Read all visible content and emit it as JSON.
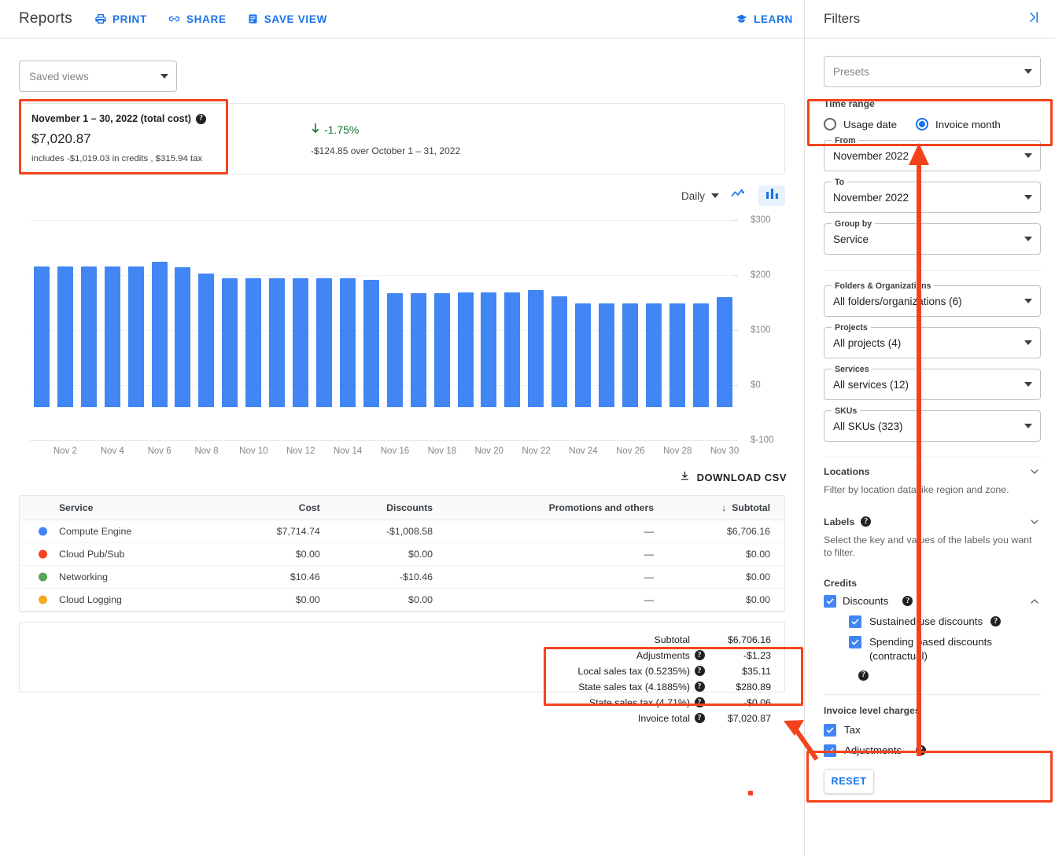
{
  "header": {
    "title": "Reports",
    "actions": [
      {
        "label": "PRINT",
        "icon": "printer-icon"
      },
      {
        "label": "SHARE",
        "icon": "link-icon"
      },
      {
        "label": "SAVE VIEW",
        "icon": "save-document-icon"
      }
    ],
    "learn": {
      "label": "LEARN",
      "icon": "graduation-cap-icon"
    }
  },
  "saved_views": {
    "placeholder": "Saved views"
  },
  "summary": {
    "title": "November 1 – 30, 2022 (total cost)",
    "amount": "$7,020.87",
    "note": "includes -$1,019.03 in credits , $315.94 tax",
    "delta": "-1.75%",
    "delta_direction": "down",
    "delta_color": "#137333",
    "comparison": "-$124.85 over October 1 – 31, 2022"
  },
  "chart_controls": {
    "granularity": "Daily",
    "line_mode_label": "line-chart",
    "bar_mode_label": "bar-chart",
    "active_mode": "bar"
  },
  "chart_data": {
    "type": "bar",
    "title": "",
    "xlabel": "",
    "ylabel": "",
    "ylim": [
      -100,
      300
    ],
    "yticks": [
      300,
      200,
      100,
      0,
      -100
    ],
    "ytick_labels": [
      "$300",
      "$200",
      "$100",
      "$0",
      "$-100"
    ],
    "grid": true,
    "series_color": "#4285f4",
    "categories": [
      "Nov 1",
      "Nov 2",
      "Nov 3",
      "Nov 4",
      "Nov 5",
      "Nov 6",
      "Nov 7",
      "Nov 8",
      "Nov 9",
      "Nov 10",
      "Nov 11",
      "Nov 12",
      "Nov 13",
      "Nov 14",
      "Nov 15",
      "Nov 16",
      "Nov 17",
      "Nov 18",
      "Nov 19",
      "Nov 20",
      "Nov 21",
      "Nov 22",
      "Nov 23",
      "Nov 24",
      "Nov 25",
      "Nov 26",
      "Nov 27",
      "Nov 28",
      "Nov 29",
      "Nov 30"
    ],
    "values": [
      256,
      256,
      256,
      256,
      256,
      264,
      255,
      243,
      234,
      234,
      234,
      234,
      234,
      234,
      231,
      207,
      207,
      207,
      208,
      208,
      208,
      213,
      201,
      189,
      189,
      189,
      189,
      189,
      189,
      200
    ],
    "xtick_labels": [
      "Nov 2",
      "Nov 4",
      "Nov 6",
      "Nov 8",
      "Nov 10",
      "Nov 12",
      "Nov 14",
      "Nov 16",
      "Nov 18",
      "Nov 20",
      "Nov 22",
      "Nov 24",
      "Nov 26",
      "Nov 28",
      "Nov 30"
    ],
    "xtick_indices": [
      1,
      3,
      5,
      7,
      9,
      11,
      13,
      15,
      17,
      19,
      21,
      23,
      25,
      27,
      29
    ]
  },
  "download": {
    "label": "DOWNLOAD CSV",
    "icon": "download-icon"
  },
  "table": {
    "columns": [
      "Service",
      "Cost",
      "Discounts",
      "Promotions and others",
      "Subtotal"
    ],
    "sorted_column": "Subtotal",
    "sort_icon": "arrow-down-icon",
    "rows": [
      {
        "color": "#4285f4",
        "service": "Compute Engine",
        "cost": "$7,714.74",
        "discounts": "-$1,008.58",
        "promotions": "—",
        "subtotal": "$6,706.16"
      },
      {
        "color": "#f4431c",
        "service": "Cloud Pub/Sub",
        "cost": "$0.00",
        "discounts": "$0.00",
        "promotions": "—",
        "subtotal": "$0.00"
      },
      {
        "color": "#5aa454",
        "service": "Networking",
        "cost": "$10.46",
        "discounts": "-$10.46",
        "promotions": "—",
        "subtotal": "$0.00"
      },
      {
        "color": "#f9a825",
        "service": "Cloud Logging",
        "cost": "$0.00",
        "discounts": "$0.00",
        "promotions": "—",
        "subtotal": "$0.00"
      }
    ]
  },
  "totals": [
    {
      "label": "Subtotal",
      "help": false,
      "value": "$6,706.16"
    },
    {
      "label": "Adjustments",
      "help": true,
      "value": "-$1.23"
    },
    {
      "label": "Local sales tax (0.5235%)",
      "help": true,
      "value": "$35.11"
    },
    {
      "label": "State sales tax (4.1885%)",
      "help": true,
      "value": "$280.89"
    },
    {
      "label": "State sales tax (4.71%)",
      "help": true,
      "value": "-$0.06"
    },
    {
      "label": "Invoice total",
      "help": true,
      "value": "$7,020.87"
    }
  ],
  "filters": {
    "title": "Filters",
    "collapse_icon": "collapse-panel-right-icon",
    "presets": {
      "label": "",
      "placeholder": "Presets"
    },
    "time_range": {
      "label": "Time range",
      "options": [
        {
          "label": "Usage date",
          "selected": false
        },
        {
          "label": "Invoice month",
          "selected": true
        }
      ]
    },
    "from": {
      "label": "From",
      "value": "November 2022"
    },
    "to": {
      "label": "To",
      "value": "November 2022"
    },
    "group_by": {
      "label": "Group by",
      "value": "Service"
    },
    "folders": {
      "label": "Folders & Organizations",
      "value": "All folders/organizations (6)"
    },
    "projects": {
      "label": "Projects",
      "value": "All projects (4)"
    },
    "services": {
      "label": "Services",
      "value": "All services (12)"
    },
    "skus": {
      "label": "SKUs",
      "value": "All SKUs (323)"
    },
    "locations": {
      "label": "Locations",
      "helper": "Filter by location data like region and zone.",
      "expanded": false
    },
    "labels": {
      "label": "Labels",
      "help": true,
      "helper": "Select the key and values of the labels you want to filter.",
      "expanded": false
    },
    "credits": {
      "label": "Credits",
      "discounts": {
        "label": "Discounts",
        "checked": true,
        "help": true,
        "expanded": true
      },
      "children": [
        {
          "label": "Sustained use discounts",
          "checked": true,
          "help": true
        },
        {
          "label": "Spending based discounts (contractual)",
          "checked": true,
          "help": true
        }
      ]
    },
    "invoice_level_charges": {
      "label": "Invoice level charges",
      "items": [
        {
          "label": "Tax",
          "checked": true,
          "help": false
        },
        {
          "label": "Adjustments",
          "checked": true,
          "help": true
        }
      ]
    },
    "reset": {
      "label": "RESET"
    }
  },
  "annotation": {
    "color": "#f4431c"
  }
}
